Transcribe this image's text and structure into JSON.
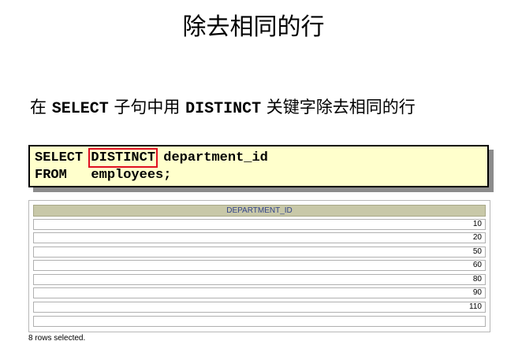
{
  "slide": {
    "title": "除去相同的行"
  },
  "subtitle": {
    "prefix": "在 ",
    "keyword1": "SELECT",
    "middle": " 子句中用 ",
    "keyword2": "DISTINCT",
    "suffix": " 关键字除去相同的行"
  },
  "code": {
    "line1_select": "SELECT ",
    "line1_distinct": "DISTINCT",
    "line1_rest": " department_id",
    "line2": "FROM   employees;"
  },
  "result": {
    "column_header": "DEPARTMENT_ID",
    "rows": [
      "10",
      "20",
      "50",
      "60",
      "80",
      "90",
      "110",
      ""
    ],
    "status": "8 rows selected."
  },
  "colors": {
    "code_background": "#ffffcc",
    "highlight_border": "#e01020",
    "header_background": "#c8c8a8",
    "header_text": "#334488"
  }
}
